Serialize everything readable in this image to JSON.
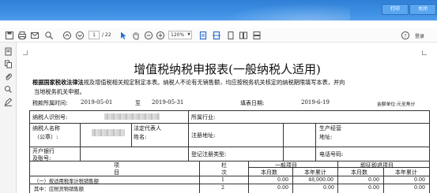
{
  "titlebar": {
    "print_label": "打印",
    "close_label": "关闭"
  },
  "toolbar": {
    "page_current": "1",
    "page_total": "/ 22",
    "zoom": "120%",
    "login_label": "登录"
  },
  "document": {
    "title": "增值税纳税申报表(一般纳税人适用)",
    "intro_bold": "根据国家税收法律法",
    "intro_rest_1": "规及增值税相关规定制定本表。纳税人不论有无销售额，均应按税务机关核定的纳税期限填写本表，并向",
    "intro_rest_2": "当地税务机关申报。",
    "period_label": "税款所属时间:",
    "period_from": "2019-05-01",
    "period_to_word": "至",
    "period_to": "2019-05-31",
    "fill_date_label": "填表日期:",
    "fill_date": "2019-6-19",
    "unit_label": "金额单位:元至角分"
  },
  "form": {
    "taxpayer_id_label": "纳税人识别号:",
    "industry_label": "所属行业:",
    "taxpayer_name_label": "纳税人名称",
    "taxpayer_name_sub": "（公章）:",
    "legal_rep_label_1": "法定代表人",
    "legal_rep_label_2": "姓名:",
    "reg_address_label": "注册地址:",
    "biz_address_label_1": "生产经营",
    "biz_address_label_2": "地址:",
    "bank_label_1": "开户银行",
    "bank_label_2": "及账号:",
    "reg_type_label": "登记注册类型:",
    "phone_label": "电话号码:",
    "item_header": "项",
    "item_header_2": "目",
    "col_header_1": "栏",
    "col_header_2": "次",
    "general_items": "一般项目",
    "refund_items": "即征即退项目",
    "this_month": "本月数",
    "year_total": "本年累计",
    "rows": [
      {
        "label": "（一）按适用税率计税销售额",
        "no": "1",
        "v1": "0.00",
        "v2": "48,000.00",
        "v3": "0.00",
        "v4": "0.00"
      },
      {
        "label": "其中：应税货物销售额",
        "no": "2",
        "v1": "0.00",
        "v2": "0.00",
        "v3": "0.00",
        "v4": "0.00"
      }
    ]
  },
  "colors": {
    "titlebar": "#3d8fe4",
    "accent_icon": "#2a6fd0",
    "table_line": "#333333"
  }
}
